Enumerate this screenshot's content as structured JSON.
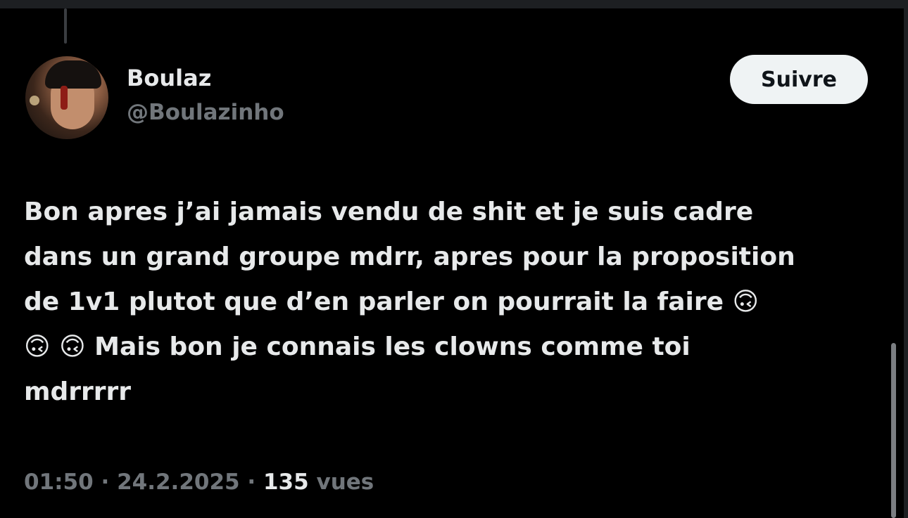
{
  "tweet": {
    "author": {
      "display_name": "Boulaz",
      "handle": "@Boulazinho"
    },
    "follow_label": "Suivre",
    "text": "Bon apres j’ai jamais vendu de shit et je suis cadre\ndans un grand groupe mdrr, apres pour la proposition\nde 1v1 plutot que d’en parler on pourrait la faire 🙃\n🙃 🙃 Mais bon je connais les clowns comme toi\nmdrrrrr",
    "time": "01:50",
    "separator": " · ",
    "date": "24.2.2025",
    "views_count": "135",
    "views_label": " vues"
  },
  "colors": {
    "background": "#000000",
    "primary_text": "#e7e9ea",
    "secondary_text": "#71767b",
    "follow_button_bg": "#eff3f4"
  }
}
